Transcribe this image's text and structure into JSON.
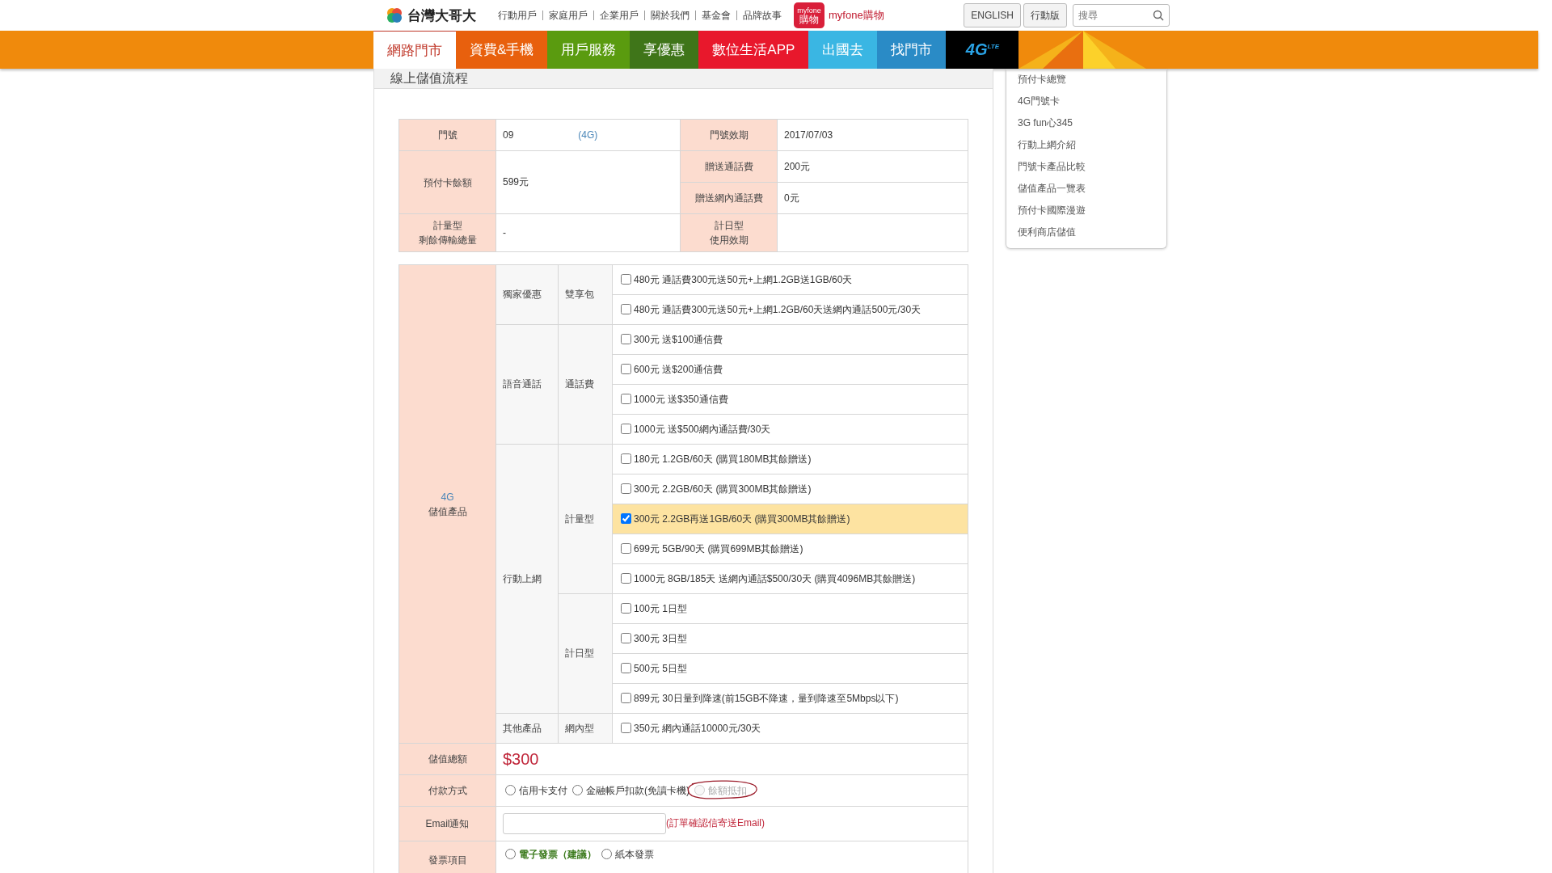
{
  "header": {
    "brand": "台灣大哥大",
    "links": [
      "行動用戶",
      "家庭用戶",
      "企業用戶",
      "關於我們",
      "基金會",
      "品牌故事"
    ],
    "shop": {
      "badge_top": "myfone",
      "badge": "購物",
      "label": "myfone購物"
    },
    "buttons": [
      "ENGLISH",
      "行動版"
    ],
    "search": {
      "placeholder": "搜尋"
    }
  },
  "nav": {
    "items": [
      {
        "label": "網路門市",
        "selected": true,
        "color": "#ffffff"
      },
      {
        "label": "資費&手機",
        "selected": false,
        "color": "#e8600d"
      },
      {
        "label": "用戶服務",
        "selected": false,
        "color": "#5a9b0f"
      },
      {
        "label": "享優惠",
        "selected": false,
        "color": "#3f7519"
      },
      {
        "label": "數位生活APP",
        "selected": false,
        "color": "#e8182c"
      },
      {
        "label": "出國去",
        "selected": false,
        "color": "#3ab6e3"
      },
      {
        "label": "找門市",
        "selected": false,
        "color": "#2a8bc6"
      }
    ],
    "lte_logo": {
      "main": "4G",
      "sup": "LTE"
    }
  },
  "page_title": "線上儲值流程",
  "info": {
    "number_label": "門號",
    "number": "09",
    "number_tag": "(4G)",
    "expiry_label": "門號效期",
    "expiry": "2017/07/03",
    "balance_label": "預付卡餘額",
    "balance": "599元",
    "bonus_call_label": "贈送通話費",
    "bonus_call": "200元",
    "bonus_onnet_label": "贈送網內通話費",
    "bonus_onnet": "0元",
    "data_left_label": [
      "計量型",
      "剩餘傳輸總量"
    ],
    "data_left": "-",
    "daily_label": [
      "計日型",
      "使用效期"
    ]
  },
  "products": {
    "label_top": "4G",
    "label": "儲值產品",
    "groups": [
      {
        "name": "獨家優惠",
        "subgroups": [
          {
            "name": "雙享包",
            "options": [
              {
                "label": "480元 通話費300元送50元+上網1.2GB送1GB/60天",
                "checked": false
              },
              {
                "label": "480元 通話費300元送50元+上網1.2GB/60天送網內通話500元/30天",
                "checked": false
              }
            ]
          }
        ]
      },
      {
        "name": "語音通話",
        "subgroups": [
          {
            "name": "通話費",
            "options": [
              {
                "label": "300元 送$100通信費",
                "checked": false
              },
              {
                "label": "600元 送$200通信費",
                "checked": false
              },
              {
                "label": "1000元 送$350通信費",
                "checked": false
              },
              {
                "label": "1000元 送$500網內通話費/30天",
                "checked": false
              }
            ]
          }
        ]
      },
      {
        "name": "行動上網",
        "subgroups": [
          {
            "name": "計量型",
            "options": [
              {
                "label": "180元 1.2GB/60天 (購買180MB其餘贈送)",
                "checked": false
              },
              {
                "label": "300元 2.2GB/60天 (購買300MB其餘贈送)",
                "checked": false
              },
              {
                "label": "300元 2.2GB再送1GB/60天 (購買300MB其餘贈送)",
                "checked": true
              },
              {
                "label": "699元 5GB/90天 (購買699MB其餘贈送)",
                "checked": false
              },
              {
                "label": "1000元 8GB/185天 送網內通話$500/30天 (購買4096MB其餘贈送)",
                "checked": false
              }
            ]
          },
          {
            "name": "計日型",
            "options": [
              {
                "label": "100元 1日型",
                "checked": false
              },
              {
                "label": "300元 3日型",
                "checked": false
              },
              {
                "label": "500元 5日型",
                "checked": false
              },
              {
                "label": "899元 30日量到降速(前15GB不降速，量到降速至5Mbps以下)",
                "checked": false
              }
            ]
          }
        ]
      },
      {
        "name": "其他產品",
        "subgroups": [
          {
            "name": "網內型",
            "options": [
              {
                "label": "350元 網內通話10000元/30天",
                "checked": false
              }
            ]
          }
        ]
      }
    ]
  },
  "total": {
    "label": "儲值總額",
    "value": "$300"
  },
  "payment": {
    "label": "付款方式",
    "options": [
      {
        "label": "信用卡支付",
        "selected": false,
        "disabled": false,
        "circled": false
      },
      {
        "label": "金融帳戶扣款(免讀卡機)",
        "selected": false,
        "disabled": false,
        "circled": false
      },
      {
        "label": "餘額抵扣",
        "selected": false,
        "disabled": true,
        "circled": true
      }
    ]
  },
  "email": {
    "label": "Email通知",
    "note": "(訂單確認信寄送Email)"
  },
  "invoice": {
    "label": "發票項目",
    "options": [
      {
        "label": "電子發票（建議）",
        "selected": false,
        "recommended": true
      },
      {
        "label": "紙本發票",
        "selected": false,
        "recommended": false
      }
    ]
  },
  "sidebar": {
    "items": [
      "預付卡總覽",
      "4G門號卡",
      "3G fun心345",
      "行動上網介紹",
      "門號卡產品比較",
      "儲值產品一覽表",
      "預付卡國際漫遊",
      "便利商店儲值"
    ]
  }
}
